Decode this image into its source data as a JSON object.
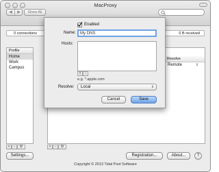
{
  "window": {
    "title": "MacProxy"
  },
  "toolbar": {
    "show_all_label": "Show All"
  },
  "status": {
    "connections": "0 connections",
    "received": "0 B received"
  },
  "profiles": {
    "header": "Profile",
    "items": [
      "Home",
      "Work",
      "Campus"
    ],
    "selected": "Home"
  },
  "rules": {
    "resolve_header": "Resolve",
    "resolve_value": "Remote"
  },
  "sheet": {
    "enabled_label": "Enabled",
    "enabled_checked": true,
    "name_label": "Name:",
    "name_value": "My DNS",
    "hosts_label": "Hosts:",
    "hosts_hint": "e.g. *.apple.com",
    "resolve_label": "Resolve:",
    "resolve_value": "Local",
    "cancel_label": "Cancel",
    "save_label": "Save"
  },
  "footer": {
    "settings_label": "Settings...",
    "registration_label": "Registration...",
    "about_label": "About...",
    "copyright": "Copyright © 2013 Tidal Pool Software"
  },
  "colors": {
    "accent": "#6ea2e6",
    "selection": "#dcdcdc",
    "window": "#ececec"
  }
}
